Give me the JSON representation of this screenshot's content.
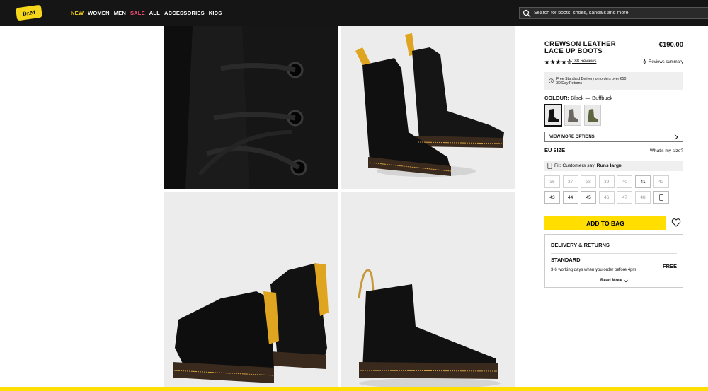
{
  "header": {
    "logo_text": "Dr. Martens",
    "nav": [
      "NEW",
      "WOMEN",
      "MEN",
      "SALE",
      "ALL",
      "ACCESSORIES",
      "KIDS"
    ],
    "search_placeholder": "Search for boots, shoes, sandals and more"
  },
  "gallery": {
    "images": [
      {
        "name": "laces close-up"
      },
      {
        "name": "boot front three-quarter"
      },
      {
        "name": "pair back view"
      },
      {
        "name": "boot side view"
      }
    ]
  },
  "product": {
    "title": "CREWSON LEATHER LACE UP BOOTS",
    "price": "€190.00",
    "rating": 4.5,
    "reviews_link": "188 Reviews",
    "reviews_summary": "Reviews summary",
    "delivery_line1": "Free Standard Delivery on orders over €50",
    "delivery_line2": "30 Day Returns",
    "colour_label": "COLOUR:",
    "colour_value": "Black — Buffbuck",
    "view_more": "VIEW MORE OPTIONS",
    "size_label": "EU SIZE",
    "whats_my_size": "What's my size?",
    "fit_prefix": "Fit: Customers say",
    "fit_value": "Runs large",
    "sizes": [
      {
        "label": "36",
        "available": false
      },
      {
        "label": "37",
        "available": false
      },
      {
        "label": "38",
        "available": false
      },
      {
        "label": "39",
        "available": false
      },
      {
        "label": "40",
        "available": false
      },
      {
        "label": "41",
        "available": true
      },
      {
        "label": "42",
        "available": false
      },
      {
        "label": "43",
        "available": true
      },
      {
        "label": "44",
        "available": true
      },
      {
        "label": "45",
        "available": true
      },
      {
        "label": "46",
        "available": false
      },
      {
        "label": "47",
        "available": false
      },
      {
        "label": "48",
        "available": false
      }
    ],
    "add_to_bag": "ADD TO BAG"
  },
  "delivery_returns": {
    "title": "DELIVERY & RETURNS",
    "option": "STANDARD",
    "option_price": "FREE",
    "days": "3-6 working days when you order before 4pm",
    "read_more": "Read More"
  },
  "colors": {
    "header_bg": "#151515",
    "accent_yellow": "#ffde00",
    "sale_pink": "#ff4d7d"
  }
}
